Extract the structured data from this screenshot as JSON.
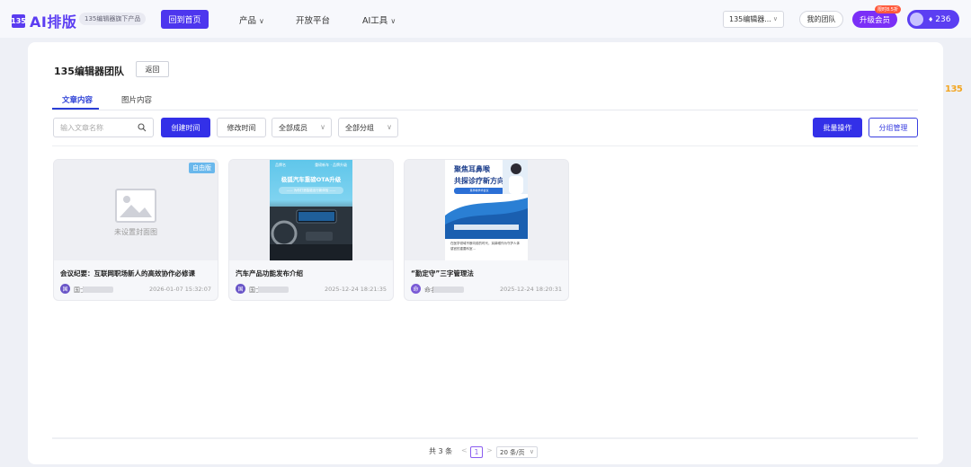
{
  "header": {
    "logo_mark": "135",
    "logo_text": "AI排版",
    "logo_sub": "135编辑器旗下产品",
    "home_button": "回到首页",
    "nav": [
      {
        "label": "产品"
      },
      {
        "label": "开放平台"
      },
      {
        "label": "AI工具"
      }
    ],
    "team_select": "135编辑器...",
    "my_team": "我的团队",
    "upgrade": "升级会员",
    "upgrade_badge": "限时8.5折",
    "points": "236"
  },
  "page": {
    "title": "135编辑器团队",
    "back": "返回",
    "tabs": [
      {
        "label": "文章内容",
        "active": true
      },
      {
        "label": "图片内容",
        "active": false
      }
    ]
  },
  "toolbar": {
    "search_placeholder": "输入文章名称",
    "sort_created": "创建时间",
    "sort_modified": "修改时间",
    "members_select": "全部成员",
    "groups_select": "全部分组",
    "batch": "批量操作",
    "group_manage": "分组管理"
  },
  "articles": [
    {
      "title": "会议纪要：互联网职场新人的高效协作必修课",
      "badge": "自由版",
      "placeholder": "未设置封面图",
      "avatar": "国",
      "author": "国士",
      "date": "2026-01-07 15:32:07"
    },
    {
      "title": "汽车产品功能发布介绍",
      "poster_title": "极狐汽车重磅OTA升级",
      "poster_tl": "品牌名",
      "poster_tr": "重磅新车 · 品牌升级",
      "poster_sub": "—— 为你打造智能出行新体验 ——",
      "avatar": "国",
      "author": "国士",
      "date": "2025-12-24 18:21:35"
    },
    {
      "title": "“勤定守”三字管理法",
      "poster_line1": "聚焦耳鼻喉",
      "poster_line2": "共探诊疗新方向",
      "poster_sub": "耳鼻喉学术会议",
      "poster_text": "在医学领域不断向前的时代，耳鼻喉作为守护人体感官的重要科室...",
      "avatar": "命",
      "author": "命名",
      "date": "2025-12-24 18:20:31"
    }
  ],
  "pagination": {
    "total": "共 3 条",
    "prev": "<",
    "current": "1",
    "next": ">",
    "page_size": "20 条/页"
  },
  "side": {
    "logo": "135"
  },
  "colors": {
    "primary": "#3330e8",
    "brand": "#5b3df2",
    "accent": "#7b2ff7"
  }
}
